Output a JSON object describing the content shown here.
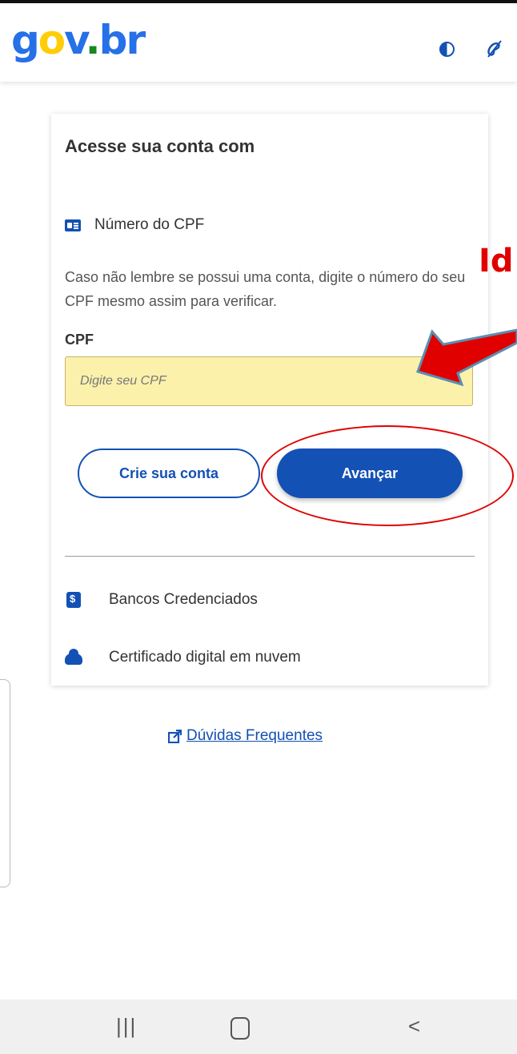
{
  "header": {
    "logo": {
      "g": "g",
      "o": "o",
      "v": "v",
      "dot": ".",
      "br": "br"
    },
    "contrast_icon": "contrast-icon",
    "accessibility_icon": "libras-icon"
  },
  "login_card": {
    "title": "Acesse sua conta com",
    "cpf_option_label": "Número do CPF",
    "help_text": "Caso não lembre se possui uma conta, digite o número do seu CPF mesmo assim para verificar.",
    "cpf_field_label": "CPF",
    "cpf_placeholder": "Digite seu CPF",
    "cpf_value": "",
    "create_account_label": "Crie sua conta",
    "next_label": "Avançar",
    "alternatives": [
      {
        "label": "Bancos Credenciados",
        "icon": "bank-icon"
      },
      {
        "label": "Certificado digital em nuvem",
        "icon": "cloud-icon"
      }
    ]
  },
  "faq": {
    "label": "Dúvidas Frequentes",
    "icon": "external-link-icon"
  },
  "annotation": {
    "text": "Id",
    "color": "#e00000"
  },
  "colors": {
    "primary": "#1351b4",
    "input_bg": "#fbf1ab",
    "annotation": "#e00000"
  },
  "navbar": {
    "recents": "|||",
    "back": "<"
  }
}
